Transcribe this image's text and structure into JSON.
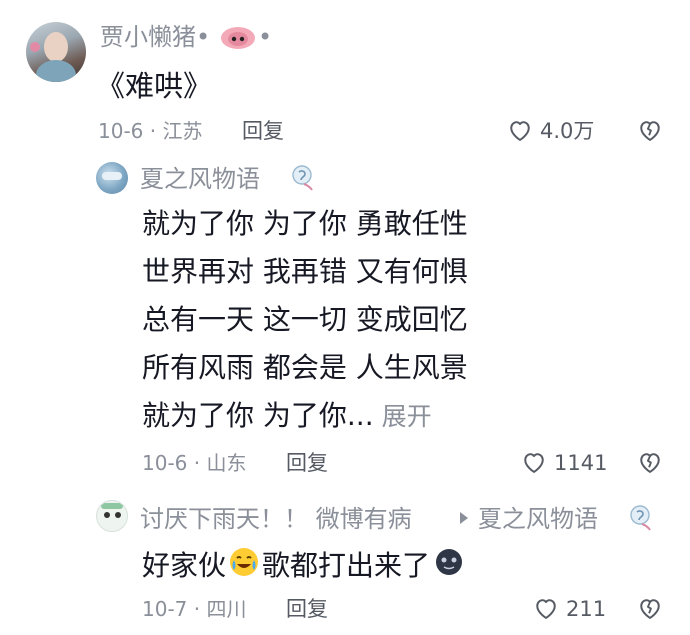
{
  "comments": [
    {
      "username": "贾小懒猪•",
      "username_suffix": "•",
      "text": "《难哄》",
      "date_loc": "10-6 · 江苏",
      "reply_label": "回复",
      "like_count": "4.0万"
    },
    {
      "username": "夏之风物语",
      "lines": [
        "就为了你 为了你 勇敢任性",
        "世界再对 我再错 又有何惧",
        "总有一天 这一切 变成回忆",
        "所有风雨 都会是 人生风景",
        "就为了你 为了你..."
      ],
      "expand_label": "展开",
      "date_loc": "10-6 · 山东",
      "reply_label": "回复",
      "like_count": "1141"
    },
    {
      "username": "讨厌下雨天！！ 微博有病",
      "reply_to": "夏之风物语",
      "text_part1": "好家伙",
      "text_part2": "歌都打出来了",
      "date_loc": "10-7 · 四川",
      "reply_label": "回复",
      "like_count": "211"
    }
  ],
  "icons": {
    "like": "heart-outline-icon",
    "dislike": "broken-heart-icon",
    "pig": "pig-face-icon",
    "arrow": "reply-arrow-icon"
  },
  "colors": {
    "meta": "#8a8f99",
    "text": "#161823",
    "pig": "#f0a4b4"
  }
}
